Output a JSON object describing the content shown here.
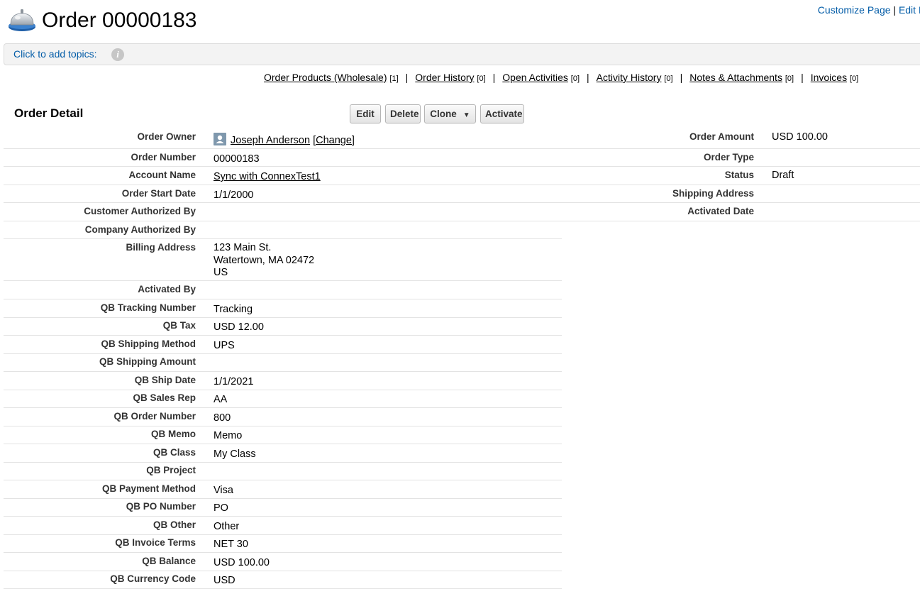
{
  "header": {
    "title": "Order 00000183",
    "customize_link": "Customize Page",
    "separator": "|",
    "edit_layout_link": "Edit Layout"
  },
  "topics": {
    "link": "Click to add topics:",
    "info_glyph": "i"
  },
  "related_lists": [
    {
      "label": "Order Products (Wholesale)",
      "count": "[1]"
    },
    {
      "label": "Order History",
      "count": "[0]"
    },
    {
      "label": "Open Activities",
      "count": "[0]"
    },
    {
      "label": "Activity History",
      "count": "[0]"
    },
    {
      "label": "Notes & Attachments",
      "count": "[0]"
    },
    {
      "label": "Invoices",
      "count": "[0]"
    }
  ],
  "related_separator": "|",
  "detail": {
    "title": "Order Detail",
    "buttons": {
      "edit": "Edit",
      "delete": "Delete",
      "clone": "Clone",
      "clone_caret": "▼",
      "activate": "Activate"
    },
    "owner": {
      "label": "Order Owner",
      "name": "Joseph Anderson",
      "change": "[Change]"
    },
    "left_fields": [
      {
        "label": "Order Number",
        "value": "00000183"
      },
      {
        "label": "Account Name",
        "value": "Sync with ConnexTest1",
        "link": true
      },
      {
        "label": "Order Start Date",
        "value": "1/1/2000"
      },
      {
        "label": "Customer Authorized By",
        "value": ""
      },
      {
        "label": "Company Authorized By",
        "value": ""
      }
    ],
    "billing": {
      "label": "Billing Address",
      "line1": "123 Main St.",
      "line2": "Watertown, MA 02472",
      "line3": "US"
    },
    "right_fields": [
      {
        "label": "Order Amount",
        "value": "USD 100.00"
      },
      {
        "label": "Order Type",
        "value": ""
      },
      {
        "label": "Status",
        "value": "Draft"
      },
      {
        "label": "Shipping Address",
        "value": ""
      },
      {
        "label": "Activated Date",
        "value": ""
      }
    ],
    "qb_fields": [
      {
        "label": "Activated By",
        "value": ""
      },
      {
        "label": "QB Tracking Number",
        "value": "Tracking"
      },
      {
        "label": "QB Tax",
        "value": "USD 12.00"
      },
      {
        "label": "QB Shipping Method",
        "value": "UPS"
      },
      {
        "label": "QB Shipping Amount",
        "value": ""
      },
      {
        "label": "QB Ship Date",
        "value": "1/1/2021"
      },
      {
        "label": "QB Sales Rep",
        "value": "AA"
      },
      {
        "label": "QB Order Number",
        "value": "800"
      },
      {
        "label": "QB Memo",
        "value": "Memo"
      },
      {
        "label": "QB Class",
        "value": "My Class"
      },
      {
        "label": "QB Project",
        "value": ""
      },
      {
        "label": "QB Payment Method",
        "value": "Visa"
      },
      {
        "label": "QB PO Number",
        "value": "PO"
      },
      {
        "label": "QB Other",
        "value": "Other"
      },
      {
        "label": "QB Invoice Terms",
        "value": "NET 30"
      },
      {
        "label": "QB Balance",
        "value": "USD 100.00"
      },
      {
        "label": "QB Currency Code",
        "value": "USD"
      }
    ]
  },
  "icons": {
    "order": "service-bell-icon",
    "info": "info-icon",
    "owner": "user-avatar-icon"
  }
}
